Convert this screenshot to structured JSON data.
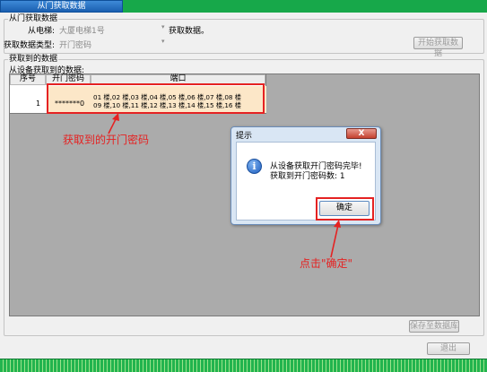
{
  "tab": {
    "label": "从门获取数据"
  },
  "from_door": {
    "legend": "从门获取数据",
    "elevator_label": "从电梯:",
    "elevator_value": "大厦电梯1号",
    "status_label": "获取数据。",
    "type_label": "获取数据类型:",
    "type_value": "开门密码",
    "start_button": "开始获取数据"
  },
  "data_group": {
    "legend": "获取到的数据",
    "sub_label": "从设备获取到的数据:"
  },
  "table": {
    "headers": [
      "序号",
      "开门密码",
      "端口"
    ],
    "rows": [
      {
        "index": "1",
        "password": "*******0",
        "ports_line1": "01 楼,02 楼,03 楼,04 楼,05 楼,06 楼,07 楼,08 楼",
        "ports_line2": "09 楼,10 楼,11 楼,12 楼,13 楼,14 楼,15 楼,16 楼"
      }
    ]
  },
  "annotations": {
    "password_note": "获取到的开门密码",
    "click_note": "点击\"确定\""
  },
  "dialog": {
    "title": "提示",
    "close": "X",
    "message_line1": "从设备获取开门密码完毕!",
    "message_line2": "获取到开门密码数: 1",
    "ok_button": "确定"
  },
  "footer": {
    "save_button": "保存至数据库",
    "exit_button": "退出"
  },
  "colors": {
    "annotation_red": "#e52222",
    "tab_blue": "#2a72c4",
    "bar_green": "#17a84a"
  }
}
